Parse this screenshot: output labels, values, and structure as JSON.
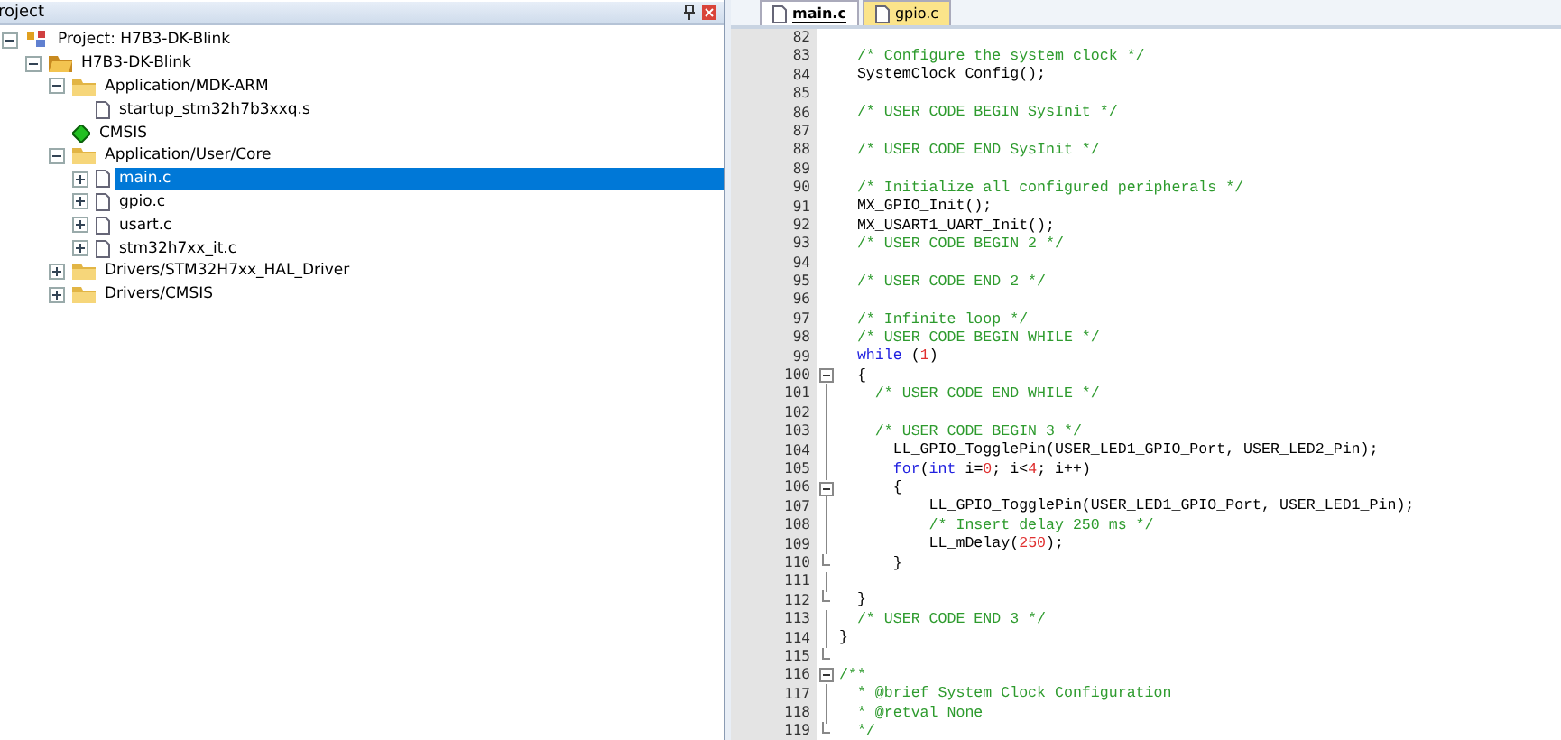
{
  "project_panel": {
    "title": "roject",
    "tree": [
      {
        "label": "Project: H7B3-DK-Blink",
        "kind": "project",
        "expanded": true,
        "selected": false,
        "children": [
          {
            "label": "H7B3-DK-Blink",
            "kind": "target",
            "expanded": true,
            "selected": false,
            "children": [
              {
                "label": "Application/MDK-ARM",
                "kind": "folder",
                "expanded": true,
                "selected": false,
                "children": [
                  {
                    "label": "startup_stm32h7b3xxq.s",
                    "kind": "file",
                    "selected": false
                  }
                ]
              },
              {
                "label": "CMSIS",
                "kind": "component",
                "selected": false
              },
              {
                "label": "Application/User/Core",
                "kind": "folder",
                "expanded": true,
                "selected": false,
                "children": [
                  {
                    "label": "main.c",
                    "kind": "file",
                    "expanded": false,
                    "selected": true
                  },
                  {
                    "label": "gpio.c",
                    "kind": "file",
                    "expanded": false,
                    "selected": false
                  },
                  {
                    "label": "usart.c",
                    "kind": "file",
                    "expanded": false,
                    "selected": false
                  },
                  {
                    "label": "stm32h7xx_it.c",
                    "kind": "file",
                    "expanded": false,
                    "selected": false
                  }
                ]
              },
              {
                "label": "Drivers/STM32H7xx_HAL_Driver",
                "kind": "folder",
                "expanded": false,
                "selected": false
              },
              {
                "label": "Drivers/CMSIS",
                "kind": "folder",
                "expanded": false,
                "selected": false
              }
            ]
          }
        ]
      }
    ]
  },
  "editor": {
    "tabs": [
      {
        "label": "main.c",
        "selected": true
      },
      {
        "label": "gpio.c",
        "selected": false
      }
    ],
    "lines": [
      {
        "number": "82",
        "kind": "plain"
      },
      {
        "number": "83",
        "kind": "plain",
        "tokens": [
          {
            "kind": "comment",
            "text": "  /* Configure the system clock */"
          }
        ]
      },
      {
        "number": "84",
        "kind": "plain",
        "tokens": [
          {
            "kind": "code",
            "text": "  SystemClock_Config();"
          }
        ]
      },
      {
        "number": "85",
        "kind": "plain"
      },
      {
        "number": "86",
        "kind": "plain",
        "tokens": [
          {
            "kind": "comment",
            "text": "  /* USER CODE BEGIN SysInit */"
          }
        ]
      },
      {
        "number": "87",
        "kind": "plain"
      },
      {
        "number": "88",
        "kind": "plain",
        "tokens": [
          {
            "kind": "comment",
            "text": "  /* USER CODE END SysInit */"
          }
        ]
      },
      {
        "number": "89",
        "kind": "plain"
      },
      {
        "number": "90",
        "kind": "plain",
        "tokens": [
          {
            "kind": "comment",
            "text": "  /* Initialize all configured peripherals */"
          }
        ]
      },
      {
        "number": "91",
        "kind": "plain",
        "tokens": [
          {
            "kind": "code",
            "text": "  MX_GPIO_Init();"
          }
        ]
      },
      {
        "number": "92",
        "kind": "plain",
        "tokens": [
          {
            "kind": "code",
            "text": "  MX_USART1_UART_Init();"
          }
        ]
      },
      {
        "number": "93",
        "kind": "plain",
        "tokens": [
          {
            "kind": "comment",
            "text": "  /* USER CODE BEGIN 2 */"
          }
        ]
      },
      {
        "number": "94",
        "kind": "plain"
      },
      {
        "number": "95",
        "kind": "plain",
        "tokens": [
          {
            "kind": "comment",
            "text": "  /* USER CODE END 2 */"
          }
        ]
      },
      {
        "number": "96",
        "kind": "plain"
      },
      {
        "number": "97",
        "kind": "plain",
        "tokens": [
          {
            "kind": "comment",
            "text": "  /* Infinite loop */"
          }
        ]
      },
      {
        "number": "98",
        "kind": "plain",
        "tokens": [
          {
            "kind": "comment",
            "text": "  /* USER CODE BEGIN WHILE */"
          }
        ]
      },
      {
        "number": "99",
        "kind": "plain",
        "tokens": [
          {
            "kind": "keyword",
            "text": "  while"
          },
          {
            "kind": "code",
            "text": " ("
          },
          {
            "kind": "number",
            "text": "1"
          },
          {
            "kind": "code",
            "text": ")"
          }
        ]
      },
      {
        "number": "100",
        "kind": "foldstart",
        "tokens": [
          {
            "kind": "code",
            "text": "  {"
          }
        ]
      },
      {
        "number": "101",
        "kind": "foldbody",
        "tokens": [
          {
            "kind": "comment",
            "text": "    /* USER CODE END WHILE */"
          }
        ]
      },
      {
        "number": "102",
        "kind": "foldbody"
      },
      {
        "number": "103",
        "kind": "foldbody",
        "tokens": [
          {
            "kind": "comment",
            "text": "    /* USER CODE BEGIN 3 */"
          }
        ]
      },
      {
        "number": "104",
        "kind": "foldbody",
        "tokens": [
          {
            "kind": "code",
            "text": "      LL_GPIO_TogglePin(USER_LED1_GPIO_Port, USER_LED2_Pin);"
          }
        ]
      },
      {
        "number": "105",
        "kind": "foldbody",
        "tokens": [
          {
            "kind": "keyword",
            "text": "      for"
          },
          {
            "kind": "code",
            "text": "("
          },
          {
            "kind": "keyword",
            "text": "int"
          },
          {
            "kind": "code",
            "text": " i="
          },
          {
            "kind": "number",
            "text": "0"
          },
          {
            "kind": "code",
            "text": "; i<"
          },
          {
            "kind": "number",
            "text": "4"
          },
          {
            "kind": "code",
            "text": "; i++)"
          }
        ]
      },
      {
        "number": "106",
        "kind": "foldstart",
        "tokens": [
          {
            "kind": "code",
            "text": "      {"
          }
        ]
      },
      {
        "number": "107",
        "kind": "foldbody",
        "tokens": [
          {
            "kind": "code",
            "text": "          LL_GPIO_TogglePin(USER_LED1_GPIO_Port, USER_LED1_Pin);"
          }
        ]
      },
      {
        "number": "108",
        "kind": "foldbody",
        "tokens": [
          {
            "kind": "comment",
            "text": "          /* Insert delay 250 ms */"
          }
        ]
      },
      {
        "number": "109",
        "kind": "foldbody",
        "tokens": [
          {
            "kind": "code",
            "text": "          LL_mDelay("
          },
          {
            "kind": "number",
            "text": "250"
          },
          {
            "kind": "code",
            "text": ");"
          }
        ]
      },
      {
        "number": "110",
        "kind": "foldend",
        "tokens": [
          {
            "kind": "code",
            "text": "      }"
          }
        ]
      },
      {
        "number": "111",
        "kind": "foldbody"
      },
      {
        "number": "112",
        "kind": "foldend",
        "tokens": [
          {
            "kind": "code",
            "text": "  }"
          }
        ]
      },
      {
        "number": "113",
        "kind": "foldbody",
        "tokens": [
          {
            "kind": "comment",
            "text": "  /* USER CODE END 3 */"
          }
        ]
      },
      {
        "number": "114",
        "kind": "foldbody",
        "tokens": [
          {
            "kind": "code",
            "text": "}"
          }
        ]
      },
      {
        "number": "115",
        "kind": "foldend"
      },
      {
        "number": "116",
        "kind": "foldstart",
        "tokens": [
          {
            "kind": "comment",
            "text": "/**"
          }
        ]
      },
      {
        "number": "117",
        "kind": "foldbody",
        "tokens": [
          {
            "kind": "comment",
            "text": "  * @brief System Clock Configuration"
          }
        ]
      },
      {
        "number": "118",
        "kind": "foldbody",
        "tokens": [
          {
            "kind": "comment",
            "text": "  * @retval None"
          }
        ]
      },
      {
        "number": "119",
        "kind": "foldend",
        "tokens": [
          {
            "kind": "comment",
            "text": "  */"
          }
        ]
      }
    ]
  }
}
